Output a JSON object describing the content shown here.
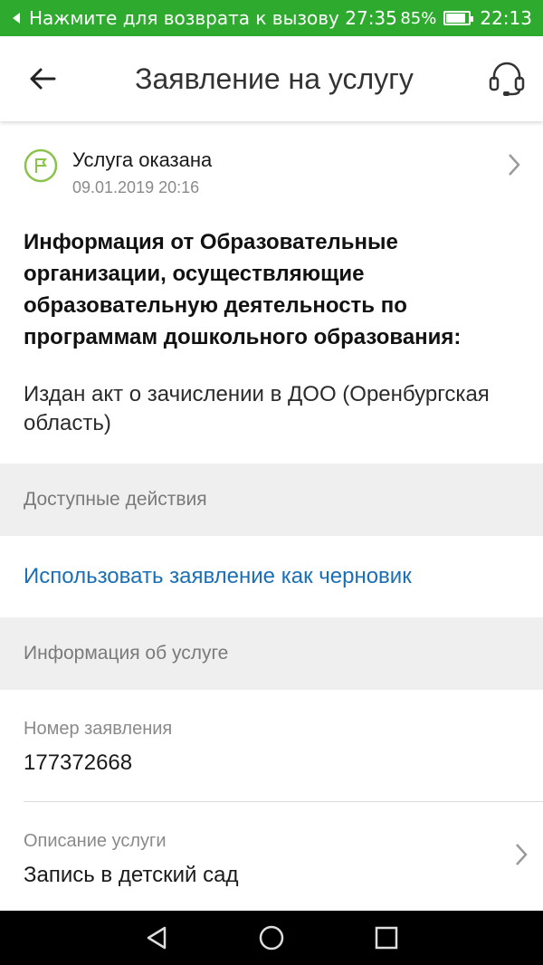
{
  "status_bar": {
    "call_text": "Нажмите для возврата к вызову 27:35",
    "battery_pct": "85%",
    "battery_level": 0.85,
    "clock": "22:13"
  },
  "app_bar": {
    "title": "Заявление на услугу",
    "back_icon": "arrow-left-icon",
    "support_icon": "headset-icon"
  },
  "service_status": {
    "title": "Услуга оказана",
    "datetime": "09.01.2019 20:16",
    "icon": "flag-icon"
  },
  "info": {
    "heading": "Информация от Образовательные организации, осуществляющие образовательную деятельность по программам дошкольного образования:",
    "body": "Издан акт о зачислении в ДОО (Оренбургская область)"
  },
  "sections": {
    "available_actions": "Доступные действия",
    "service_info": "Информация об услуге"
  },
  "actions": {
    "use_as_draft": "Использовать заявление как черновик"
  },
  "fields": {
    "application_number_label": "Номер заявления",
    "application_number_value": "177372668",
    "service_description_label": "Описание услуги",
    "service_description_value": "Запись в детский сад"
  },
  "colors": {
    "status_bar": "#2eab2e",
    "accent_link": "#1b6fb5",
    "flag_green": "#8bc34a",
    "section_bg": "#efefef"
  }
}
